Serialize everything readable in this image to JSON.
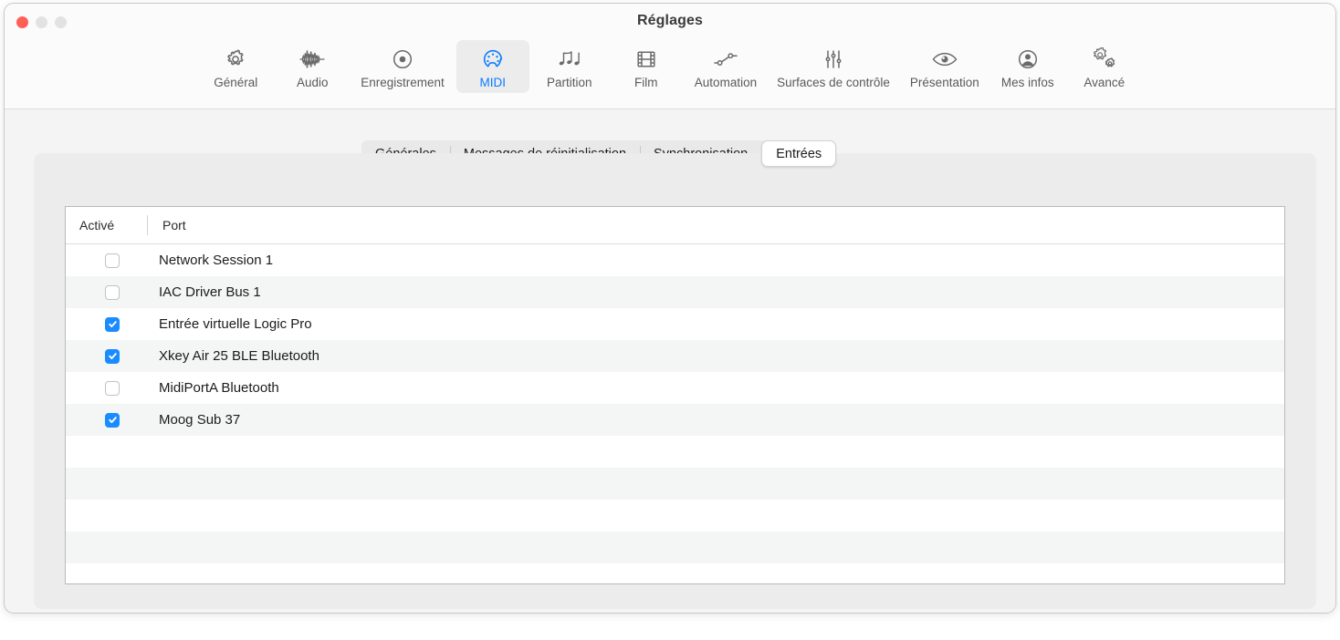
{
  "window": {
    "title": "Réglages",
    "traffic_lights": [
      {
        "name": "close",
        "color": "#ff5f57"
      },
      {
        "name": "minimize",
        "color": "#e2e2e2"
      },
      {
        "name": "maximize",
        "color": "#e2e2e2"
      }
    ]
  },
  "toolbar": {
    "items": [
      {
        "label": "Général",
        "icon": "gear-icon",
        "selected": false
      },
      {
        "label": "Audio",
        "icon": "waveform-icon",
        "selected": false
      },
      {
        "label": "Enregistrement",
        "icon": "record-circle-icon",
        "selected": false
      },
      {
        "label": "MIDI",
        "icon": "midi-connector-icon",
        "selected": true
      },
      {
        "label": "Partition",
        "icon": "music-notes-icon",
        "selected": false
      },
      {
        "label": "Film",
        "icon": "film-strip-icon",
        "selected": false
      },
      {
        "label": "Automation",
        "icon": "automation-curve-icon",
        "selected": false
      },
      {
        "label": "Surfaces de contrôle",
        "icon": "sliders-icon",
        "selected": false
      },
      {
        "label": "Présentation",
        "icon": "eye-icon",
        "selected": false
      },
      {
        "label": "Mes infos",
        "icon": "person-circle-icon",
        "selected": false
      },
      {
        "label": "Avancé",
        "icon": "double-gear-icon",
        "selected": false
      }
    ]
  },
  "tabs": [
    {
      "label": "Générales",
      "active": false
    },
    {
      "label": "Messages de réinitialisation",
      "active": false
    },
    {
      "label": "Synchronisation",
      "active": false
    },
    {
      "label": "Entrées",
      "active": true
    }
  ],
  "table": {
    "columns": [
      "Activé",
      "Port"
    ],
    "rows": [
      {
        "enabled": false,
        "port": "Network Session 1"
      },
      {
        "enabled": false,
        "port": "IAC Driver Bus 1"
      },
      {
        "enabled": true,
        "port": "Entrée virtuelle Logic Pro"
      },
      {
        "enabled": true,
        "port": "Xkey Air 25 BLE Bluetooth"
      },
      {
        "enabled": false,
        "port": "MidiPortA Bluetooth"
      },
      {
        "enabled": true,
        "port": "Moog Sub 37"
      }
    ],
    "empty_row_count": 5
  },
  "colors": {
    "accent": "#0a7cff",
    "checkbox_checked": "#1a8cff",
    "panel_bg": "#ececec",
    "content_bg": "#f4f4f4",
    "row_alt_bg": "#f4f5f5"
  }
}
